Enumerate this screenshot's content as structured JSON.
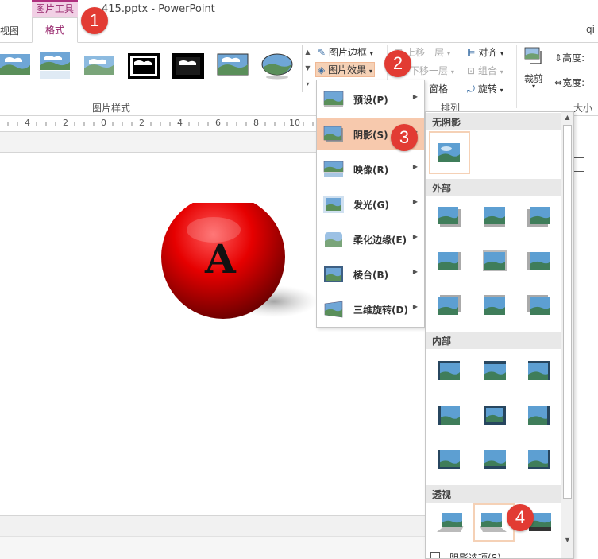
{
  "window": {
    "title": "415.pptx - PowerPoint",
    "user": "qi"
  },
  "tabs": {
    "tool_context": "图片工具",
    "format": "格式",
    "view": "视图"
  },
  "ribbon": {
    "group_picture_styles": "图片样式",
    "group_arrange": "排列",
    "group_size": "大小",
    "picture_border": "图片边框",
    "picture_effects": "图片效果",
    "bring_forward": "上移一层",
    "send_backward": "下移一层",
    "selection_pane": "窗格",
    "align": "对齐",
    "group": "组合",
    "rotate": "旋转",
    "crop": "裁剪",
    "height_label": "高度:",
    "width_label": "宽度:"
  },
  "ruler": {
    "ticks": [
      "4",
      "2",
      "0",
      "2",
      "4",
      "6",
      "8",
      "10"
    ]
  },
  "slide": {
    "sphere_letter": "A"
  },
  "effects_menu": [
    {
      "label": "预设(P)"
    },
    {
      "label": "阴影(S)"
    },
    {
      "label": "映像(R)"
    },
    {
      "label": "发光(G)"
    },
    {
      "label": "柔化边缘(E)"
    },
    {
      "label": "棱台(B)"
    },
    {
      "label": "三维旋转(D)"
    }
  ],
  "shadow_panel": {
    "no_shadow": "无阴影",
    "outer": "外部",
    "inner": "内部",
    "perspective": "透视",
    "options": "阴影选项(S)..."
  },
  "badges": [
    "1",
    "2",
    "3",
    "4"
  ],
  "colors": {
    "accent": "#96246b",
    "highlight": "#f7c9ad",
    "badge": "#e23b33",
    "sphere": "#e00000"
  }
}
